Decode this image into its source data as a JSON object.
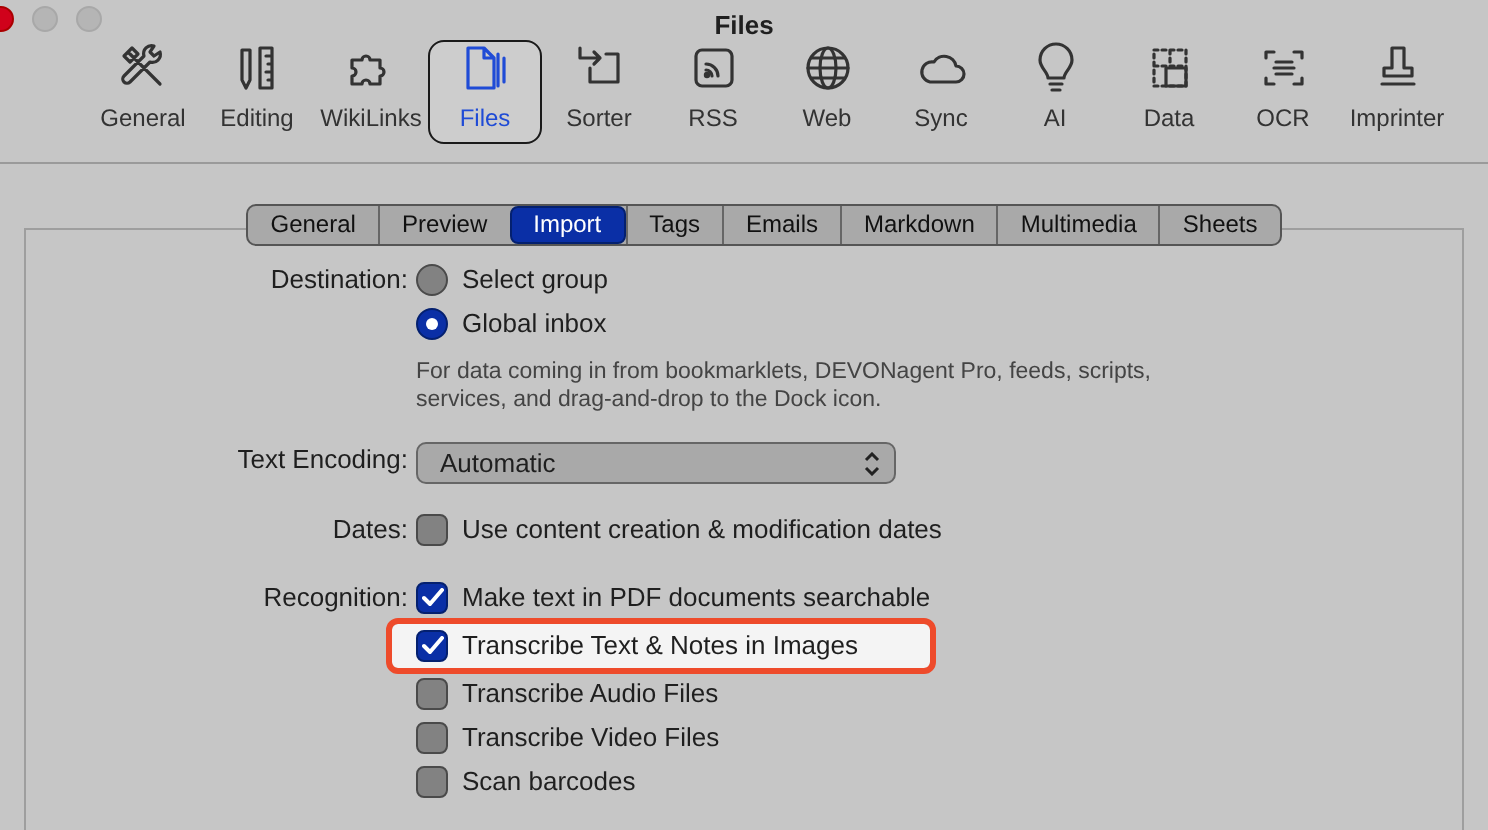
{
  "window": {
    "title": "Files"
  },
  "toolbar": [
    {
      "label": "General",
      "selected": false
    },
    {
      "label": "Editing",
      "selected": false
    },
    {
      "label": "WikiLinks",
      "selected": false
    },
    {
      "label": "Files",
      "selected": true
    },
    {
      "label": "Sorter",
      "selected": false
    },
    {
      "label": "RSS",
      "selected": false
    },
    {
      "label": "Web",
      "selected": false
    },
    {
      "label": "Sync",
      "selected": false
    },
    {
      "label": "AI",
      "selected": false
    },
    {
      "label": "Data",
      "selected": false
    },
    {
      "label": "OCR",
      "selected": false
    },
    {
      "label": "Imprinter",
      "selected": false
    }
  ],
  "tabs": [
    {
      "label": "General",
      "selected": false
    },
    {
      "label": "Preview",
      "selected": false
    },
    {
      "label": "Import",
      "selected": true
    },
    {
      "label": "Tags",
      "selected": false
    },
    {
      "label": "Emails",
      "selected": false
    },
    {
      "label": "Markdown",
      "selected": false
    },
    {
      "label": "Multimedia",
      "selected": false
    },
    {
      "label": "Sheets",
      "selected": false
    }
  ],
  "destination": {
    "label": "Destination:",
    "options": [
      {
        "label": "Select group",
        "selected": false
      },
      {
        "label": "Global inbox",
        "selected": true
      }
    ],
    "note": "For data coming in from bookmarklets, DEVONagent Pro, feeds, scripts, services, and drag-and-drop to the Dock icon."
  },
  "text_encoding": {
    "label": "Text Encoding:",
    "value": "Automatic"
  },
  "dates": {
    "label": "Dates:",
    "options": [
      {
        "label": "Use content creation & modification dates",
        "checked": false,
        "highlighted": false
      }
    ]
  },
  "recognition": {
    "label": "Recognition:",
    "options": [
      {
        "label": "Make text in PDF documents searchable",
        "checked": true,
        "highlighted": false
      },
      {
        "label": "Transcribe Text & Notes in Images",
        "checked": true,
        "highlighted": true
      },
      {
        "label": "Transcribe Audio Files",
        "checked": false,
        "highlighted": false
      },
      {
        "label": "Transcribe Video Files",
        "checked": false,
        "highlighted": false
      },
      {
        "label": "Scan barcodes",
        "checked": false,
        "highlighted": false
      }
    ]
  }
}
